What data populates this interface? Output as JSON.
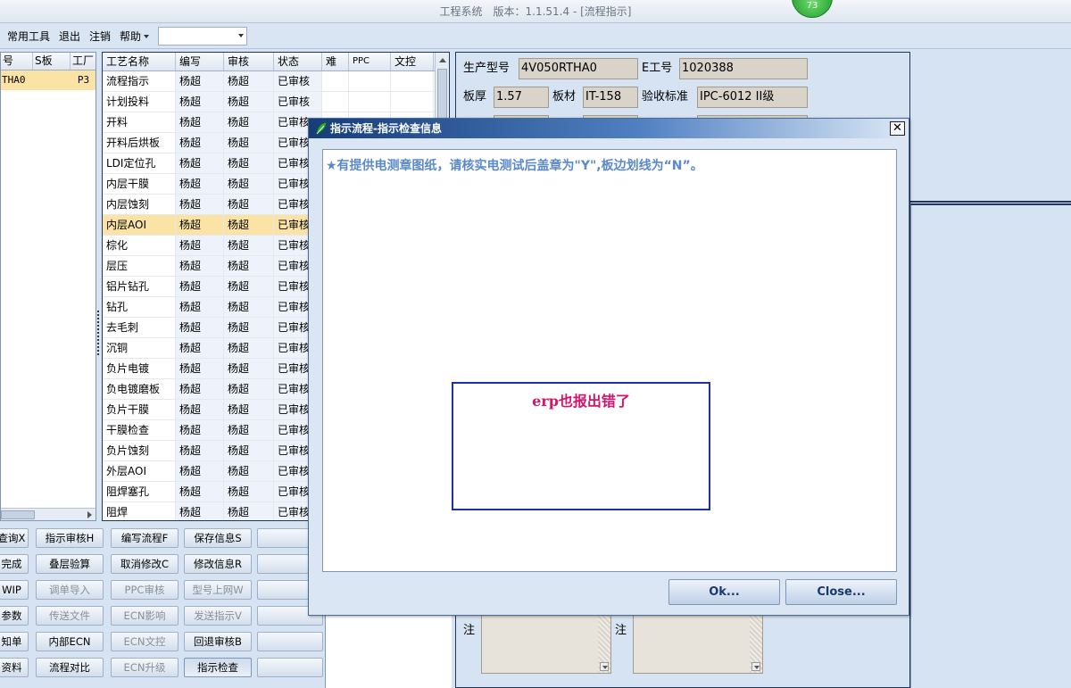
{
  "window": {
    "title": "工程系统　版本：1.1.51.4 - [流程指示]",
    "badge": "73"
  },
  "menubar": {
    "items": [
      "常用工具",
      "退出",
      "注销",
      "帮助"
    ],
    "combo_value": ""
  },
  "left_grid": {
    "headers": [
      "号",
      "S板",
      "工厂"
    ],
    "row": [
      "THA0",
      "",
      "P3"
    ]
  },
  "process_grid": {
    "headers": [
      "工艺名称",
      "编写",
      "审核",
      "状态",
      "难",
      "PPC",
      "文控"
    ],
    "rows": [
      {
        "name": "流程指示",
        "writer": "杨超",
        "reviewer": "杨超",
        "status": "已审核"
      },
      {
        "name": "计划投料",
        "writer": "杨超",
        "reviewer": "杨超",
        "status": "已审核"
      },
      {
        "name": "开料",
        "writer": "杨超",
        "reviewer": "杨超",
        "status": "已审核"
      },
      {
        "name": "开料后烘板",
        "writer": "杨超",
        "reviewer": "杨超",
        "status": "已审核"
      },
      {
        "name": "LDI定位孔",
        "writer": "杨超",
        "reviewer": "杨超",
        "status": "已审核"
      },
      {
        "name": "内层干膜",
        "writer": "杨超",
        "reviewer": "杨超",
        "status": "已审核"
      },
      {
        "name": "内层蚀刻",
        "writer": "杨超",
        "reviewer": "杨超",
        "status": "已审核"
      },
      {
        "name": "内层AOI",
        "writer": "杨超",
        "reviewer": "杨超",
        "status": "已审核"
      },
      {
        "name": "棕化",
        "writer": "杨超",
        "reviewer": "杨超",
        "status": "已审核"
      },
      {
        "name": "层压",
        "writer": "杨超",
        "reviewer": "杨超",
        "status": "已审核"
      },
      {
        "name": "铝片钻孔",
        "writer": "杨超",
        "reviewer": "杨超",
        "status": "已审核"
      },
      {
        "name": "钻孔",
        "writer": "杨超",
        "reviewer": "杨超",
        "status": "已审核"
      },
      {
        "name": "去毛刺",
        "writer": "杨超",
        "reviewer": "杨超",
        "status": "已审核"
      },
      {
        "name": "沉铜",
        "writer": "杨超",
        "reviewer": "杨超",
        "status": "已审核"
      },
      {
        "name": "负片电镀",
        "writer": "杨超",
        "reviewer": "杨超",
        "status": "已审核"
      },
      {
        "name": "负电镀磨板",
        "writer": "杨超",
        "reviewer": "杨超",
        "status": "已审核"
      },
      {
        "name": "负片干膜",
        "writer": "杨超",
        "reviewer": "杨超",
        "status": "已审核"
      },
      {
        "name": "干膜检查",
        "writer": "杨超",
        "reviewer": "杨超",
        "status": "已审核"
      },
      {
        "name": "负片蚀刻",
        "writer": "杨超",
        "reviewer": "杨超",
        "status": "已审核"
      },
      {
        "name": "外层AOI",
        "writer": "杨超",
        "reviewer": "杨超",
        "status": "已审核"
      },
      {
        "name": "阻焊塞孔",
        "writer": "杨超",
        "reviewer": "杨超",
        "status": "已审核"
      },
      {
        "name": "阻焊",
        "writer": "杨超",
        "reviewer": "杨超",
        "status": "已审核"
      }
    ],
    "selected_index": 7
  },
  "buttons": {
    "rows": [
      [
        "查询X",
        "指示审核H",
        "编写流程F",
        "保存信息S",
        ""
      ],
      [
        "完成",
        "叠层验算",
        "取消修改C",
        "修改信息R",
        ""
      ],
      [
        "WIP",
        "调单导入",
        "PPC审核",
        "型号上网W",
        ""
      ],
      [
        "参数",
        "传送文件",
        "ECN影响",
        "发送指示V",
        ""
      ],
      [
        "知单",
        "内部ECN",
        "ECN文控",
        "回退审核B",
        ""
      ],
      [
        "资料",
        "流程对比",
        "ECN升级",
        "指示检查",
        ""
      ]
    ]
  },
  "info_panel": {
    "model_label": "生产型号",
    "model_value": "4V050RTHA0",
    "e_label": "E工号",
    "e_value": "1020388",
    "thickness_label": "板厚",
    "thickness_value": "1.57",
    "material_label": "板材",
    "material_value": "IT-158",
    "standard_label": "验收标准",
    "standard_value": "IPC-6012 II级",
    "note_label_1": "注",
    "note_label_2": "注"
  },
  "dialog": {
    "title": "指示流程-指示检查信息",
    "close_glyph": "✕",
    "message": "★有提供电测章图纸，请核实电测试后盖章为\"Y\",板边划线为“N”。",
    "ok_label": "Ok...",
    "close_label": "Close..."
  },
  "annotation": {
    "text": "erp也报出错了"
  },
  "colors": {
    "selected_row": "#fbe3a6",
    "message_text": "#5b89c9",
    "annotation_border": "#1f2fa8",
    "annotation_text": "#d2166b"
  }
}
